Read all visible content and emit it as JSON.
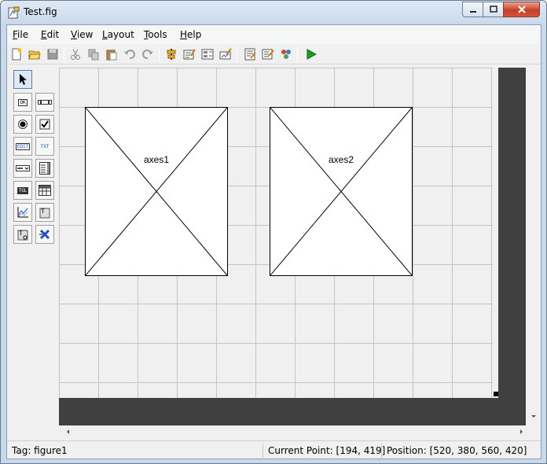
{
  "window": {
    "title": "Test.fig",
    "buttons": {
      "minimize": "minimize",
      "maximize": "maximize",
      "close": "close"
    }
  },
  "menu": [
    {
      "key": "F",
      "rest": "ile"
    },
    {
      "key": "E",
      "rest": "dit"
    },
    {
      "key": "V",
      "rest": "iew"
    },
    {
      "key": "L",
      "rest": "ayout"
    },
    {
      "key": "T",
      "rest": "ools"
    },
    {
      "key": "H",
      "rest": "elp"
    }
  ],
  "toolbar_icons": [
    "new-file-icon",
    "open-folder-icon",
    "save-icon",
    "cut-icon",
    "copy-icon",
    "paste-icon",
    "undo-icon",
    "redo-icon",
    "align-icon",
    "menu-editor-icon",
    "tab-order-icon",
    "toolbar-editor-icon",
    "mfile-editor-icon",
    "property-inspector-icon",
    "object-browser-icon",
    "run-icon"
  ],
  "palette": {
    "labels": {
      "ok": "OK",
      "edit": "EDIT",
      "txt": "TXT",
      "tgl": "TGL"
    }
  },
  "axes": [
    {
      "label": "axes1"
    },
    {
      "label": "axes2"
    }
  ],
  "status": {
    "tag": "Tag: figure1",
    "current_point": "Current Point:  [194, 419]",
    "position": "Position: [520, 380, 560, 420]"
  },
  "colors": {
    "grid_line": "#c4c4c4",
    "dark_area": "#404040",
    "run_green": "#1a9d2a"
  }
}
